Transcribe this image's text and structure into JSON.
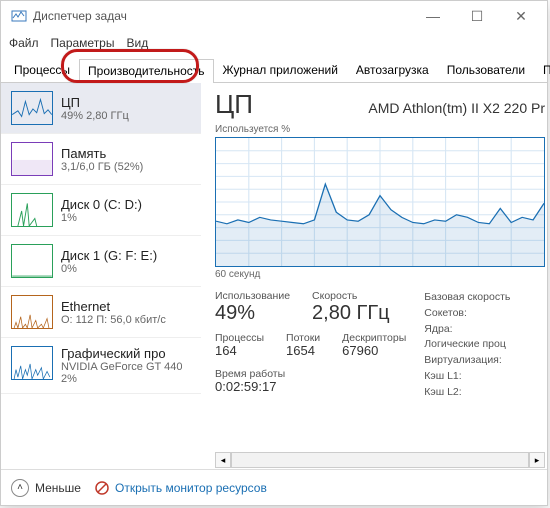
{
  "window": {
    "title": "Диспетчер задач"
  },
  "menu": {
    "file": "Файл",
    "options": "Параметры",
    "view": "Вид"
  },
  "tabs": {
    "processes": "Процессы",
    "performance": "Производительность",
    "apphistory": "Журнал приложений",
    "startup": "Автозагрузка",
    "users": "Пользователи",
    "details_trunc": "По"
  },
  "sidebar": {
    "cpu": {
      "title": "ЦП",
      "sub": "49% 2,80 ГГц"
    },
    "mem": {
      "title": "Память",
      "sub": "3,1/6,0 ГБ (52%)"
    },
    "disk0": {
      "title": "Диск 0 (C: D:)",
      "sub": "1%"
    },
    "disk1": {
      "title": "Диск 1 (G: F: E:)",
      "sub": "0%"
    },
    "eth": {
      "title": "Ethernet",
      "sub": "О: 112 П: 56,0 кбит/с"
    },
    "gpu": {
      "title": "Графический про",
      "sub": "NVIDIA GeForce GT 440",
      "sub2": "2%"
    }
  },
  "main": {
    "title": "ЦП",
    "subtitle": "AMD Athlon(tm) II X2 220 Pr",
    "chart_top_label": "Используется %",
    "chart_bottom_label": "60 секунд",
    "stats": {
      "usage_label": "Использование",
      "usage_value": "49%",
      "speed_label": "Скорость",
      "speed_value": "2,80 ГГц",
      "procs_label": "Процессы",
      "procs_value": "164",
      "threads_label": "Потоки",
      "threads_value": "1654",
      "handles_label": "Дескрипторы",
      "handles_value": "67960",
      "uptime_label": "Время работы",
      "uptime_value": "0:02:59:17"
    },
    "info": {
      "base_speed": "Базовая скорость",
      "sockets": "Сокетов:",
      "cores": "Ядра:",
      "logical": "Логические проц",
      "virt": "Виртуализация:",
      "l1": "Кэш L1:",
      "l2": "Кэш L2:"
    }
  },
  "footer": {
    "fewer": "Меньше",
    "resmon": "Открыть монитор ресурсов"
  },
  "chart_data": {
    "type": "line",
    "title": "Используется %",
    "xlabel": "60 секунд",
    "ylabel": "%",
    "ylim": [
      0,
      100
    ],
    "x_seconds": [
      60,
      58,
      56,
      54,
      52,
      50,
      48,
      46,
      44,
      42,
      40,
      38,
      36,
      34,
      32,
      30,
      28,
      26,
      24,
      22,
      20,
      18,
      16,
      14,
      12,
      10,
      8,
      6,
      4,
      2,
      0
    ],
    "values": [
      35,
      33,
      36,
      34,
      38,
      36,
      35,
      34,
      33,
      36,
      64,
      42,
      36,
      35,
      40,
      55,
      44,
      38,
      34,
      33,
      36,
      35,
      40,
      38,
      34,
      33,
      45,
      34,
      38,
      36,
      49
    ]
  }
}
